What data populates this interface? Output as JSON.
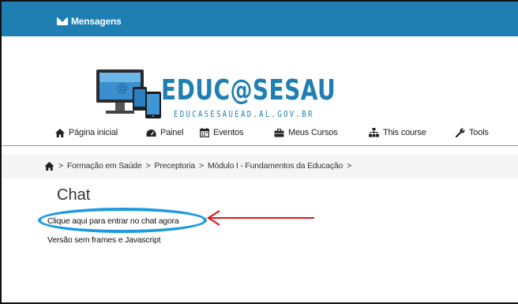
{
  "topbar": {
    "messages_label": "Mensagens"
  },
  "logo": {
    "wordmark": "EDUC@SESAU",
    "url": "EDUCASESAUEAD.AL.GOV.BR"
  },
  "nav": {
    "items": [
      {
        "label": "Página inicial",
        "icon": "home-icon"
      },
      {
        "label": "Painel",
        "icon": "dashboard-icon"
      },
      {
        "label": "Eventos",
        "icon": "calendar-icon"
      },
      {
        "label": "Meus Cursos",
        "icon": "briefcase-icon"
      },
      {
        "label": "This course",
        "icon": "sitemap-icon"
      },
      {
        "label": "Tools",
        "icon": "wrench-icon"
      }
    ]
  },
  "breadcrumb": {
    "home_icon": "home-icon",
    "separator": ">",
    "items": [
      "Formação em Saúde",
      "Preceptoria",
      "Módulo I - Fundamentos da Educação"
    ]
  },
  "main": {
    "title": "Chat",
    "links": {
      "enter_chat": "Clique aqui para entrar no chat agora",
      "no_frames": "Versão sem frames e Javascript"
    }
  },
  "colors": {
    "brand": "#1f7fb3",
    "highlight": "#1e9be0",
    "arrow": "#e01818"
  }
}
